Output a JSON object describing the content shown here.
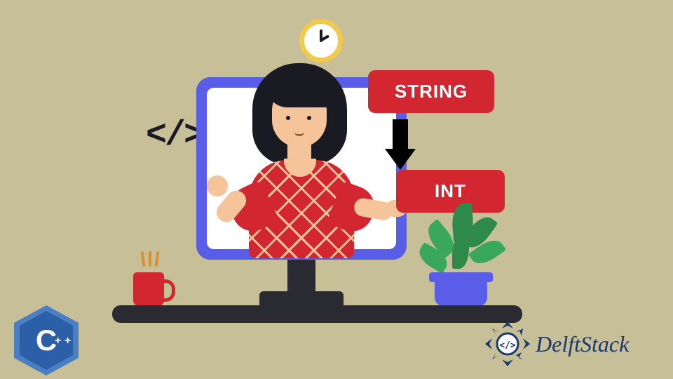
{
  "labels": {
    "string": "STRING",
    "int": "INT"
  },
  "icons": {
    "code": "</>",
    "cpp_letter": "C",
    "cpp_plus": "+"
  },
  "brand": {
    "name": "DelftStack"
  },
  "colors": {
    "bg": "#c7bf97",
    "accent_red": "#d22730",
    "accent_blue": "#5a5de8",
    "brand_blue": "#1a3a6e"
  }
}
